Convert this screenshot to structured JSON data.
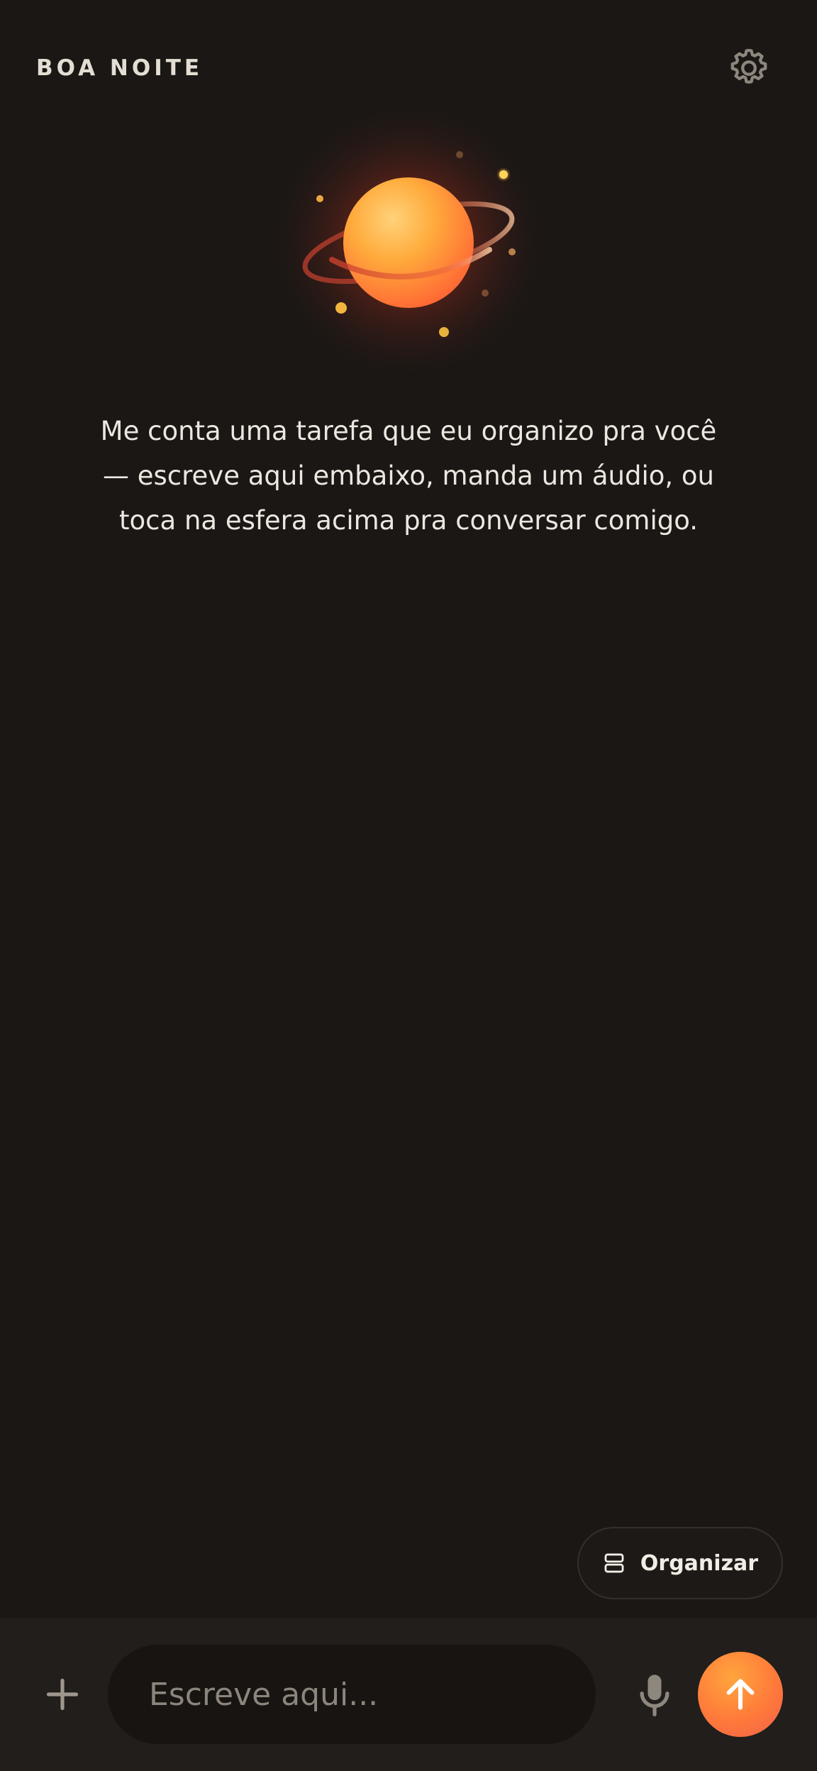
{
  "header": {
    "greeting": "BOA NOITE",
    "settings_icon": "gear-icon"
  },
  "hero": {
    "sphere_icon": "planet-orb-icon",
    "message": "Me conta uma tarefa que eu organizo pra você — escreve aqui embaixo, manda um áudio, ou toca na esfera acima pra conversar comigo."
  },
  "actions": {
    "organize_label": "Organizar",
    "organize_icon": "stacked-cards-icon"
  },
  "composer": {
    "add_icon": "plus-icon",
    "placeholder": "Escreve aqui...",
    "value": "",
    "mic_icon": "microphone-icon",
    "send_icon": "arrow-up-icon"
  },
  "colors": {
    "background": "#1a1715",
    "composer_bar": "#211e1c",
    "accent_orange": "#ff8a3d",
    "text_primary": "#ece7df",
    "text_muted": "#8c857c"
  }
}
